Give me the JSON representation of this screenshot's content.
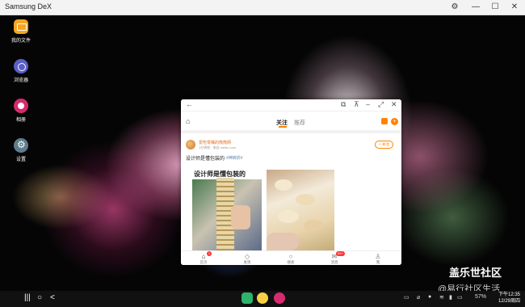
{
  "window": {
    "title": "Samsung DeX"
  },
  "desktop_icons": [
    {
      "label": "我的文件",
      "color": "#f5a623"
    },
    {
      "label": "浏览器",
      "color": "#5b5fc7"
    },
    {
      "label": "相册",
      "color": "#d62b6e"
    },
    {
      "label": "设置",
      "color": "#607d8b"
    }
  ],
  "app": {
    "tabs": {
      "following": "关注",
      "recommended": "推荐"
    },
    "post": {
      "author": "爱吃零嘴的熊熊网",
      "meta": "1分钟前 · 来自 weibo.com",
      "follow_label": "+ 关注",
      "text": "设计师是懂包装的",
      "hashtag": "#神转折#",
      "image_caption": "设计师是懂包装的"
    },
    "nav": [
      {
        "label": "首页",
        "icon": "home-icon"
      },
      {
        "label": "发现",
        "icon": "discover-icon"
      },
      {
        "label": "搜索",
        "icon": "search-icon"
      },
      {
        "label": "消息",
        "icon": "message-icon",
        "badge": "99+"
      },
      {
        "label": "我",
        "icon": "profile-icon"
      }
    ],
    "home_badge": "1"
  },
  "watermark": {
    "line1": "盖乐世社区",
    "line2": "@易行社区生活"
  },
  "taskbar": {
    "battery": "57%",
    "time": "下午12:35",
    "date": "12/29周四"
  },
  "colors": {
    "accent": "#ff8200",
    "titlebar": "#f3f3f3",
    "taskbar": "#111111"
  }
}
